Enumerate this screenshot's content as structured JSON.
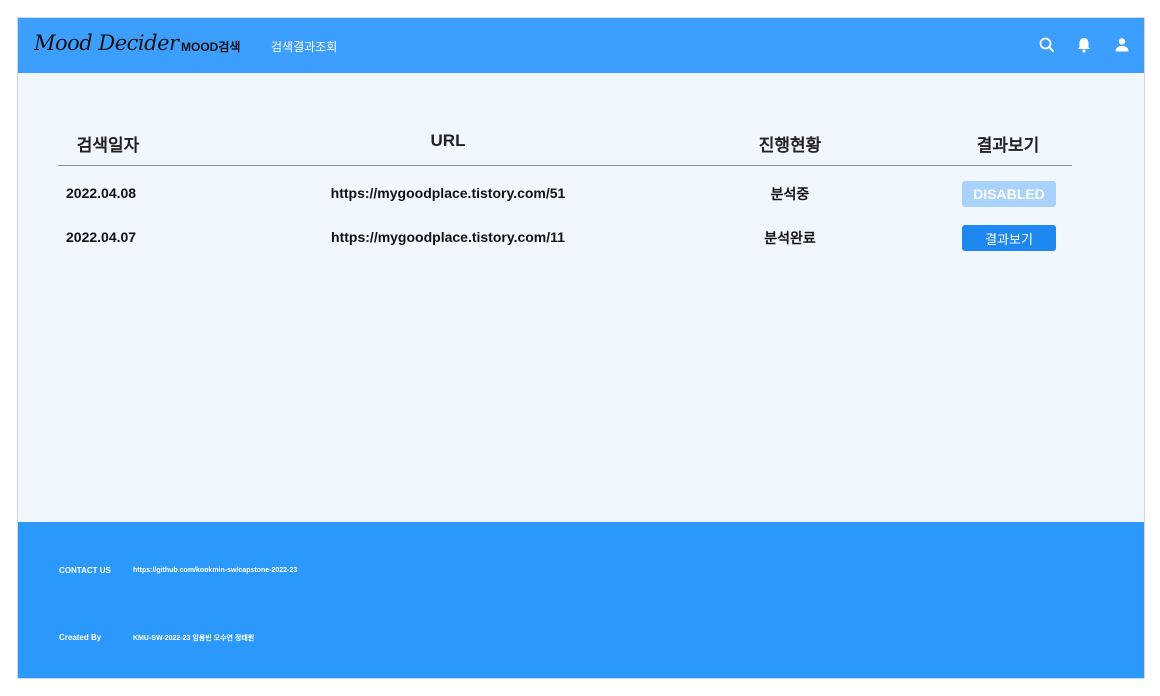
{
  "header": {
    "logo": "Mood Decider",
    "nav": {
      "mood_search": "MOOD검색",
      "results": "검색결과조회"
    },
    "icons": [
      "search-icon",
      "bell-icon",
      "user-icon"
    ]
  },
  "table": {
    "headers": {
      "date": "검색일자",
      "url": "URL",
      "status": "진행현황",
      "result": "결과보기"
    },
    "rows": [
      {
        "date": "2022.04.08",
        "url": "https://mygoodplace.tistory.com/51",
        "status": "분석중",
        "action": "DISABLED"
      },
      {
        "date": "2022.04.07",
        "url": "https://mygoodplace.tistory.com/11",
        "status": "분석완료",
        "action": "결과보기"
      }
    ]
  },
  "footer": {
    "contact_label": "CONTACT US",
    "contact_value": "https://github.com/kookmin-sw/capstone-2022-23",
    "created_label": "Created By",
    "created_value": "KMU-SW-2022-23 임용빈 오수연 정태원"
  },
  "colors": {
    "header": "#3c9ffd",
    "footer": "#2b98fb",
    "content_bg": "#f0f7ff",
    "button_active": "#1f88f0",
    "button_disabled": "#a8d1fb"
  }
}
